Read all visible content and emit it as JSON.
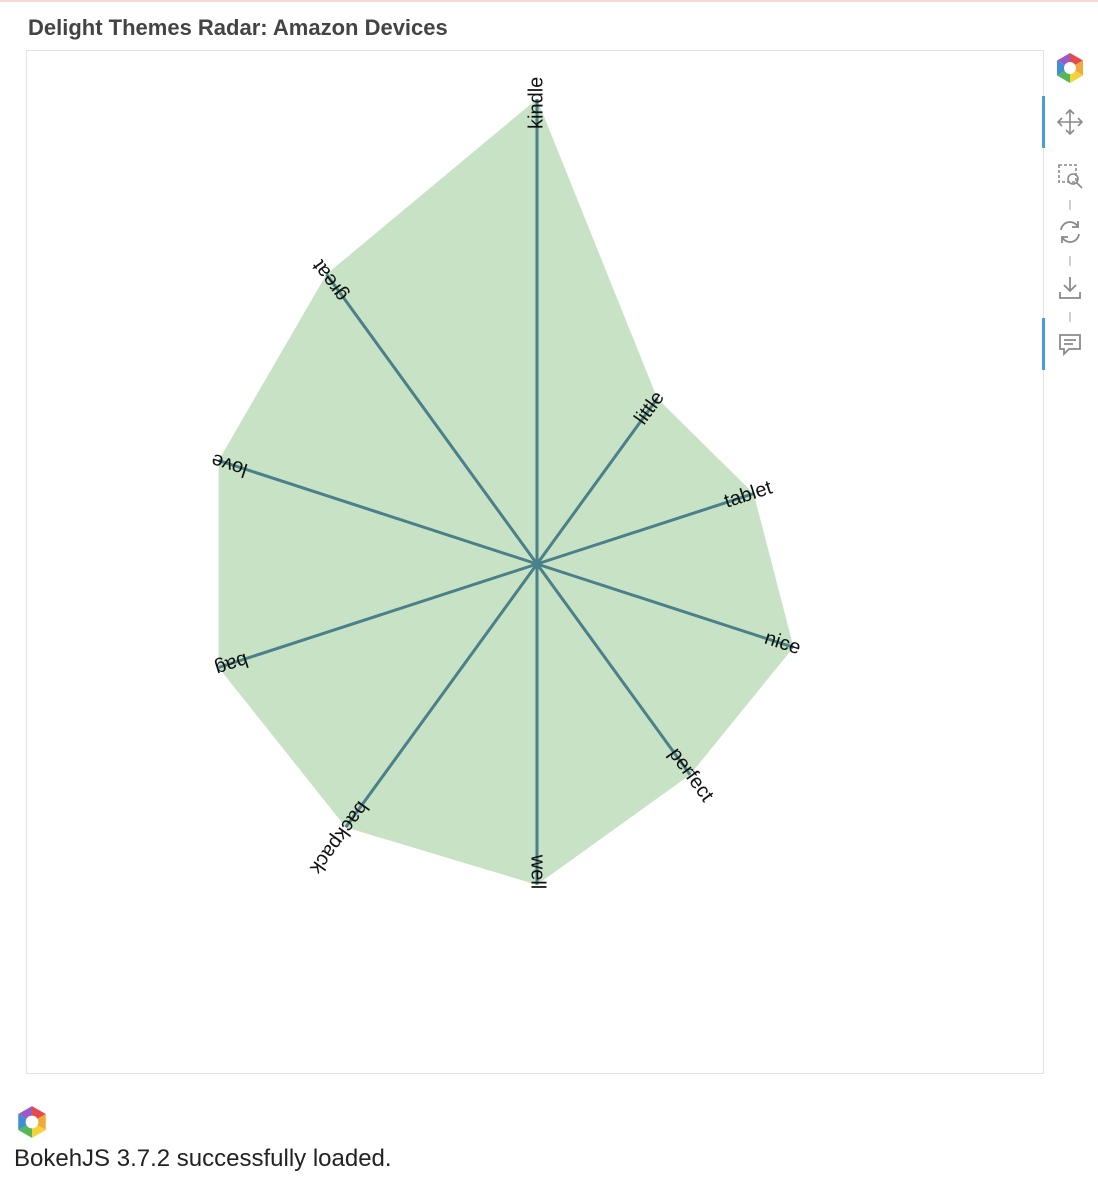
{
  "header": {
    "title": "Delight Themes Radar: Amazon Devices"
  },
  "colors": {
    "fill": "#c7e2c4",
    "spoke": "#4a8089",
    "label": "#111111",
    "accent": "#4c9fd6"
  },
  "toolbar": {
    "tools": [
      {
        "name": "bokeh-logo-icon",
        "active": false
      },
      {
        "name": "pan-icon",
        "active": true
      },
      {
        "name": "box-zoom-icon",
        "active": false
      },
      {
        "name": "reset-icon",
        "active": false
      },
      {
        "name": "save-icon",
        "active": false
      },
      {
        "name": "hover-icon",
        "active": true
      }
    ]
  },
  "chart_data": {
    "type": "radar",
    "title": "Delight Themes Radar: Amazon Devices",
    "axes": [
      "kindle",
      "little",
      "tablet",
      "nice",
      "perfect",
      "well",
      "backpack",
      "bag",
      "love",
      "great"
    ],
    "values": [
      1.0,
      0.44,
      0.49,
      0.58,
      0.56,
      0.69,
      0.7,
      0.72,
      0.72,
      0.77
    ],
    "range": [
      0,
      1
    ],
    "grid": false,
    "legend": "none"
  },
  "footer": {
    "status": "BokehJS 3.7.2 successfully loaded."
  }
}
